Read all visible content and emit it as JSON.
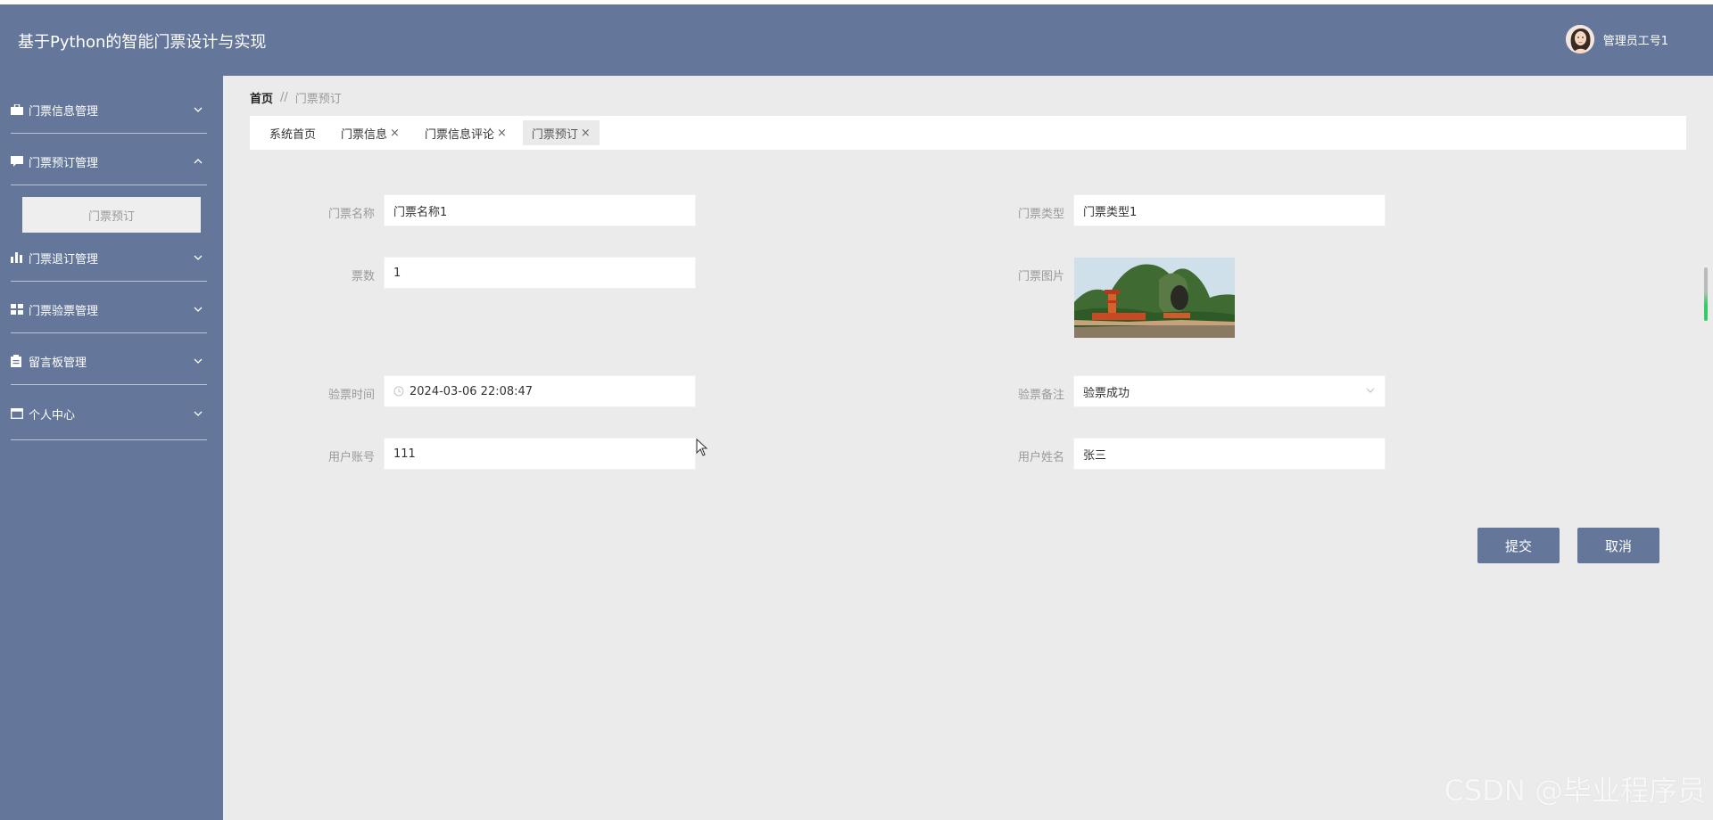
{
  "app": {
    "title": "基于Python的智能门票设计与实现",
    "user_name": "管理员工号1"
  },
  "sidebar": {
    "items": [
      {
        "label": "门票信息管理",
        "icon": "briefcase-icon",
        "expanded": false
      },
      {
        "label": "门票预订管理",
        "icon": "comment-icon",
        "expanded": true,
        "children": [
          {
            "label": "门票预订"
          }
        ]
      },
      {
        "label": "门票退订管理",
        "icon": "bar-chart-icon",
        "expanded": false
      },
      {
        "label": "门票验票管理",
        "icon": "grid-icon",
        "expanded": false
      },
      {
        "label": "留言板管理",
        "icon": "clipboard-icon",
        "expanded": false
      },
      {
        "label": "个人中心",
        "icon": "window-icon",
        "expanded": false
      }
    ]
  },
  "breadcrumb": {
    "home": "首页",
    "separator": "//",
    "current": "门票预订"
  },
  "tabs": [
    {
      "label": "系统首页",
      "closable": false,
      "active": false
    },
    {
      "label": "门票信息",
      "closable": true,
      "active": false
    },
    {
      "label": "门票信息评论",
      "closable": true,
      "active": false
    },
    {
      "label": "门票预订",
      "closable": true,
      "active": true
    }
  ],
  "tab_close_glyph": "×",
  "form": {
    "ticket_name": {
      "label": "门票名称",
      "value": "门票名称1"
    },
    "ticket_type": {
      "label": "门票类型",
      "value": "门票类型1"
    },
    "ticket_count": {
      "label": "票数",
      "value": "1"
    },
    "ticket_image": {
      "label": "门票图片"
    },
    "check_time": {
      "label": "验票时间",
      "value": "2024-03-06 22:08:47"
    },
    "check_note": {
      "label": "验票备注",
      "value": "验票成功"
    },
    "user_account": {
      "label": "用户账号",
      "value": "111"
    },
    "user_name": {
      "label": "用户姓名",
      "value": "张三"
    }
  },
  "buttons": {
    "submit": "提交",
    "cancel": "取消"
  },
  "watermark": "CSDN @毕业程序员",
  "colors": {
    "primary": "#64779b",
    "content_bg": "#ebebeb",
    "submenu_bg": "#eeeeee"
  }
}
